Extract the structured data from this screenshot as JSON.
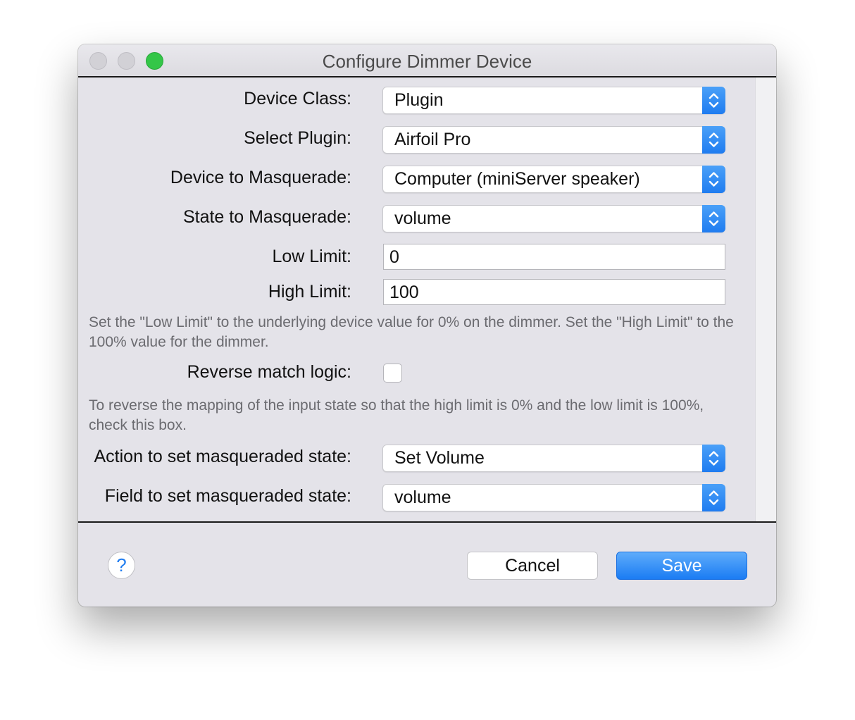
{
  "window": {
    "title": "Configure Dimmer Device"
  },
  "form": {
    "device_class": {
      "label": "Device Class:",
      "value": "Plugin"
    },
    "select_plugin": {
      "label": "Select Plugin:",
      "value": "Airfoil Pro"
    },
    "device_to_masquerade": {
      "label": "Device to Masquerade:",
      "value": "Computer (miniServer speaker)"
    },
    "state_to_masquerade": {
      "label": "State to Masquerade:",
      "value": "volume"
    },
    "low_limit": {
      "label": "Low Limit:",
      "value": "0"
    },
    "high_limit": {
      "label": "High Limit:",
      "value": "100"
    },
    "limits_help": "Set the \"Low Limit\" to the underlying device value for 0% on the dimmer.  Set the \"High Limit\" to the 100% value for the dimmer.",
    "reverse_match_logic": {
      "label": "Reverse match logic:",
      "checked": false
    },
    "reverse_help": "To reverse the mapping of the input state so that the high limit is 0% and the low limit is 100%, check this box.",
    "action_to_set": {
      "label": "Action to set masqueraded state:",
      "value": "Set Volume"
    },
    "field_to_set": {
      "label": "Field to set masqueraded state:",
      "value": "volume"
    }
  },
  "footer": {
    "help_label": "?",
    "cancel_label": "Cancel",
    "save_label": "Save"
  },
  "colors": {
    "accent": "#1f7cf0",
    "close_light": "#d2d1d6",
    "zoom_light": "#34c648"
  },
  "icons": {
    "stepper": "up-down-chevron-icon"
  }
}
